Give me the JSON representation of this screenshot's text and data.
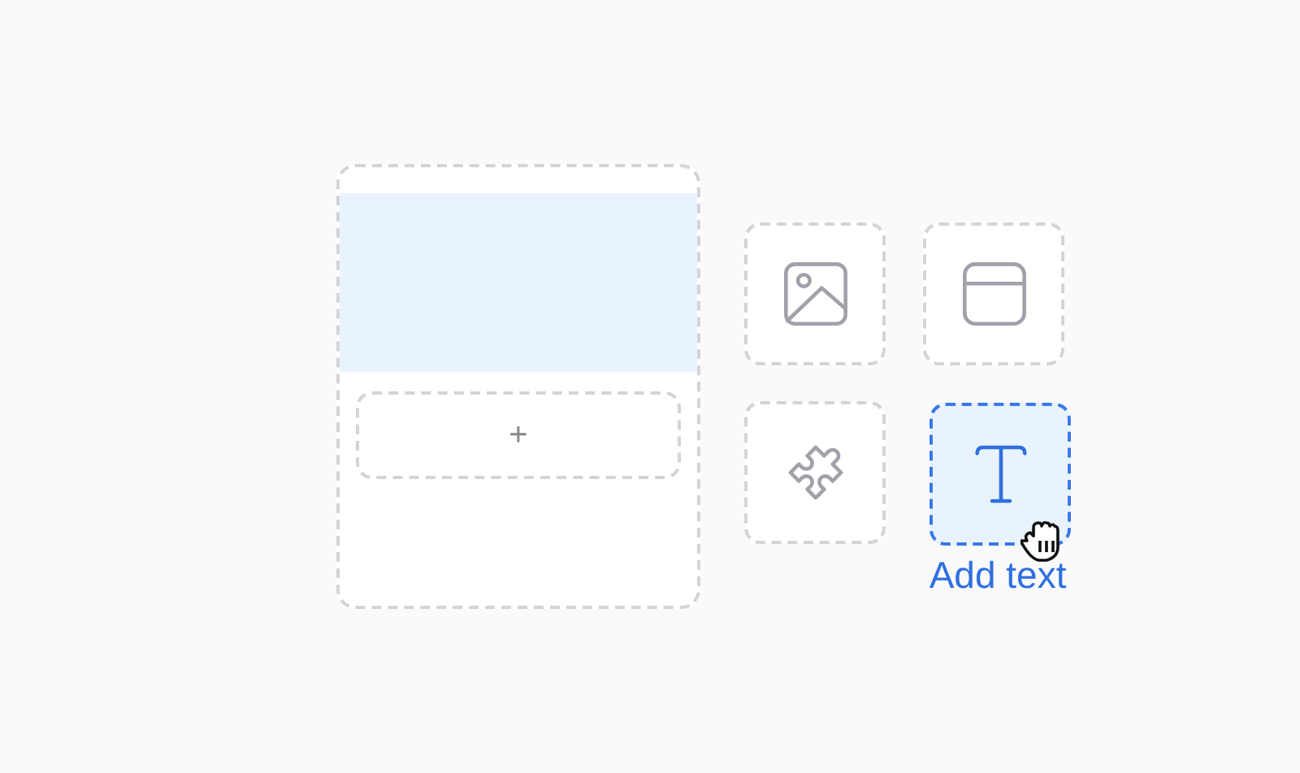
{
  "card": {
    "add_slot": {
      "text": "+"
    }
  },
  "tiles": [
    {
      "kind": "image",
      "selected": false
    },
    {
      "kind": "layout",
      "selected": false
    },
    {
      "kind": "puzzle",
      "selected": false
    },
    {
      "kind": "text",
      "selected": true,
      "label": "Add text"
    }
  ]
}
